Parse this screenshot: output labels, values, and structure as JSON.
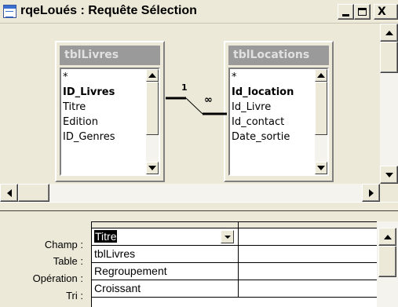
{
  "window": {
    "title": "rqeLoués : Requête Sélection",
    "min_glyph": "",
    "max_glyph": "",
    "close_glyph": "X"
  },
  "tables": [
    {
      "name": "tblLivres",
      "fields": [
        "*",
        "ID_Livres",
        "Titre",
        "Edition",
        "ID_Genres"
      ],
      "bold_field_index": 1
    },
    {
      "name": "tblLocations",
      "fields": [
        "*",
        "Id_location",
        "Id_Livre",
        "Id_contact",
        "Date_sortie"
      ],
      "bold_field_index": 1
    }
  ],
  "relationship": {
    "one_label": "1",
    "many_label": "∞"
  },
  "grid": {
    "row_labels": [
      "Champ :",
      "Table :",
      "Opération :",
      "Tri :"
    ],
    "column1": [
      "Titre",
      "tblLivres",
      "Regroupement",
      "Croissant"
    ],
    "column2": [
      "",
      "",
      "",
      ""
    ]
  },
  "colors": {
    "chrome": "#ece9d8",
    "table_header": "#9a9a9a",
    "selection": "#000000"
  }
}
